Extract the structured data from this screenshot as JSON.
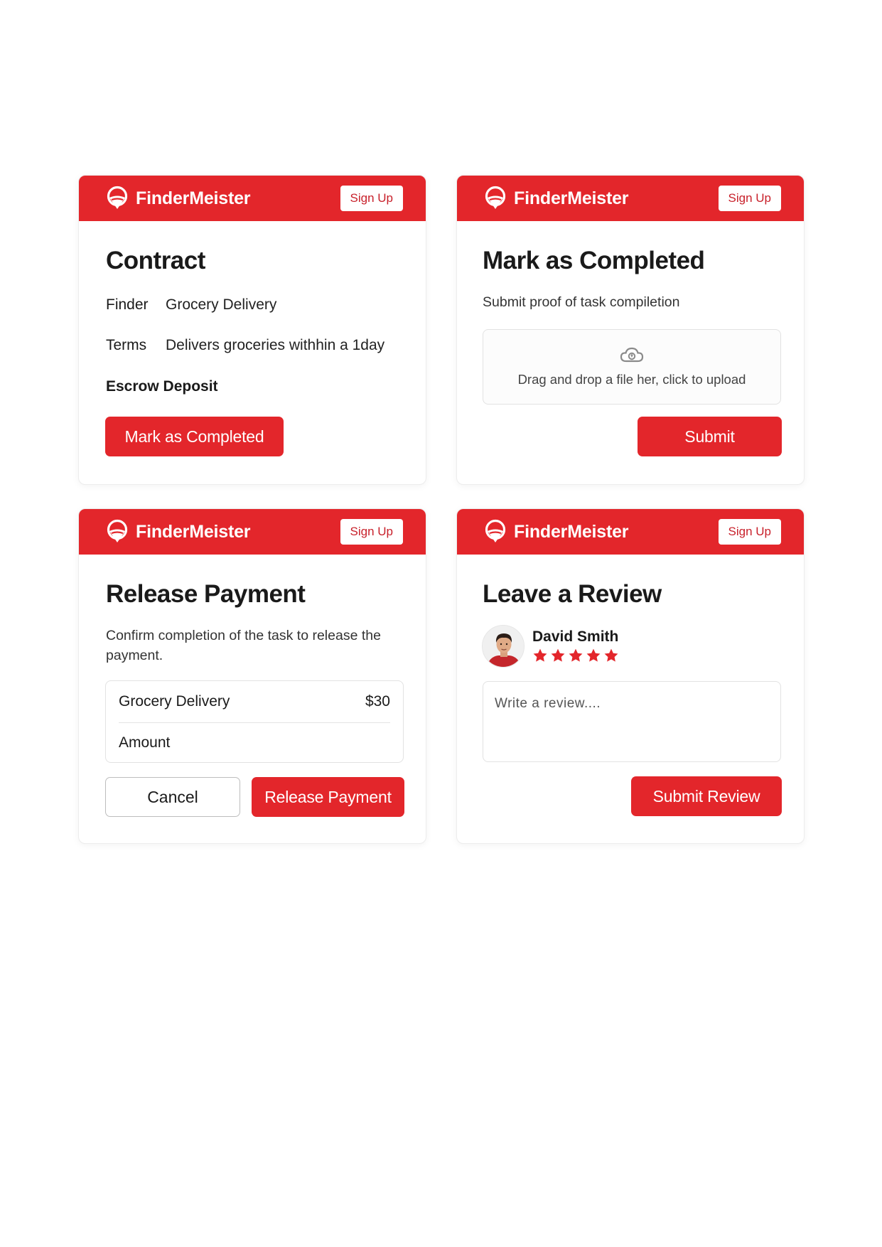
{
  "theme": {
    "brand_red": "#e3262b",
    "brand_red_dark": "#c8202a",
    "star_color": "#e3262b"
  },
  "brand": {
    "name": "FinderMeister",
    "icon": "findermeister-logo-icon",
    "signup_label": "Sign Up"
  },
  "contract": {
    "title": "Contract",
    "finder_label": "Finder",
    "finder_value": "Grocery Delivery",
    "terms_label": "Terms",
    "terms_value": "Delivers groceries withhin a 1day",
    "escrow_label": "Escrow Deposit",
    "button_label": "Mark as Completed"
  },
  "complete": {
    "title": "Mark as Completed",
    "subtitle": "Submit proof of task compiletion",
    "upload_icon": "upload-cloud-icon",
    "dropzone_text": "Drag and drop a file her, click to upload",
    "submit_label": "Submit"
  },
  "release": {
    "title": "Release Payment",
    "subtitle": "Confirm completion of the task to release the payment.",
    "item_label": "Grocery Delivery",
    "item_price": "$30",
    "amount_label": "Amount",
    "cancel_label": "Cancel",
    "release_label": "Release Payment"
  },
  "review": {
    "title": "Leave a Review",
    "reviewer_name": "David Smith",
    "rating": 5,
    "rating_max": 5,
    "placeholder": "Write a review....",
    "submit_label": "Submit Review"
  }
}
